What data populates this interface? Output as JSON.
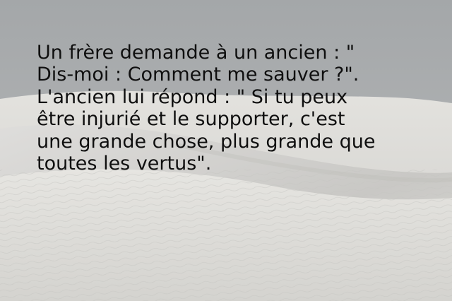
{
  "quote": {
    "lines": [
      "Un frère demande à un ancien : \"",
      "Dis-moi : Comment me sauver ?\".",
      "L'ancien lui répond : \" Si tu peux",
      "être injurié et le supporter, c'est",
      "une grande chose, plus grande que",
      "toutes les vertus\"."
    ]
  },
  "colors": {
    "sky": "#a9acae",
    "sand_far": "#d6d6d2",
    "sand_mid": "#e2e1dd",
    "sand_near": "#dcdbd7",
    "text": "#0f0f0f"
  }
}
